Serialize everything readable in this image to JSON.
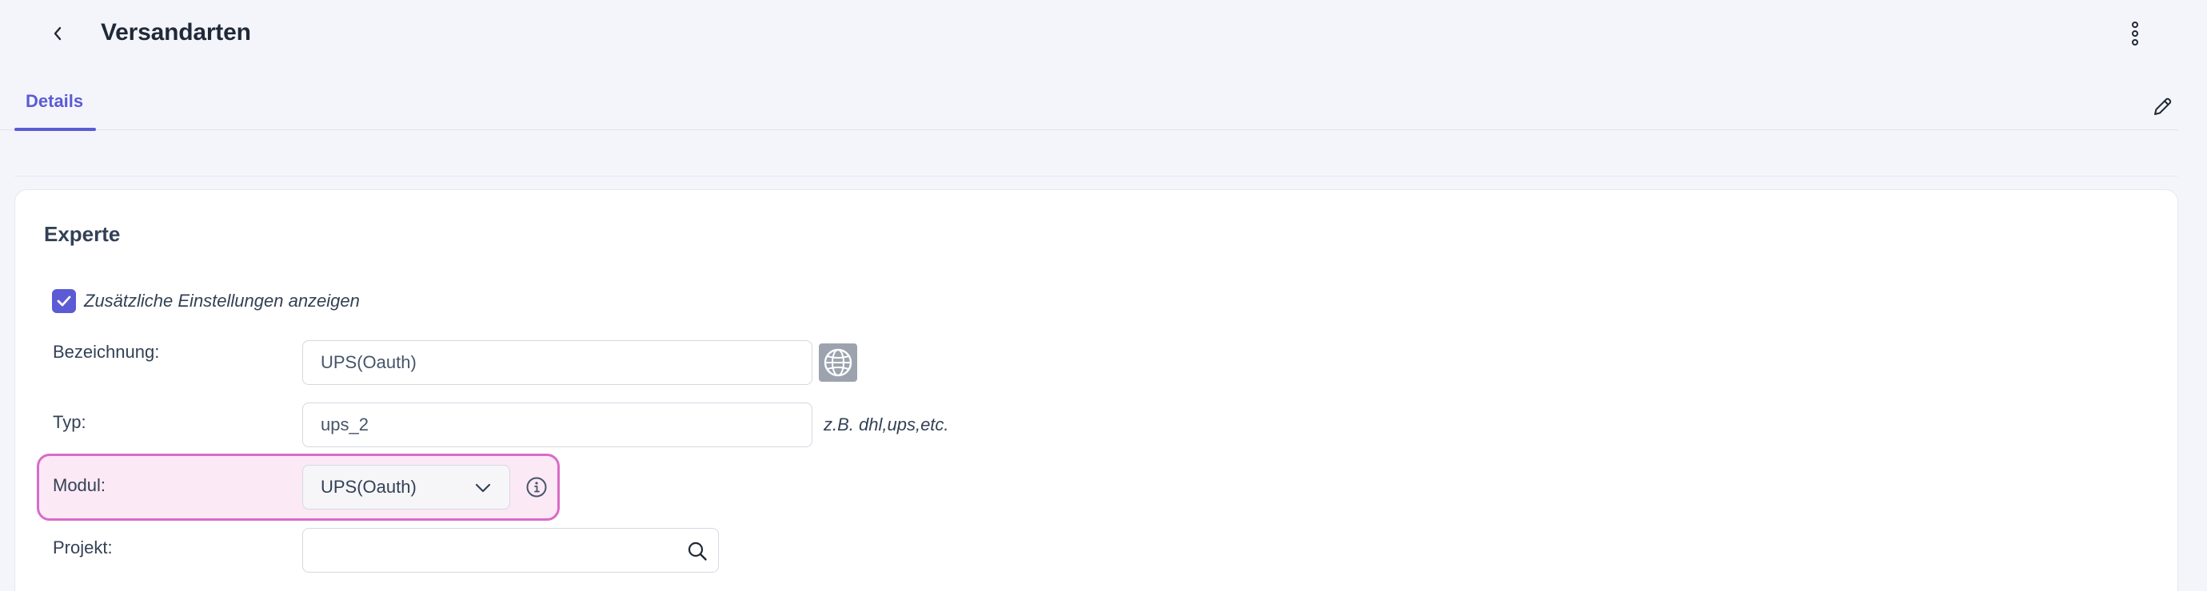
{
  "header": {
    "title": "Versandarten",
    "back_icon": "chevron-left-icon",
    "menu_icon": "kebab-menu-icon"
  },
  "tabs": [
    {
      "label": "Details",
      "active": true
    }
  ],
  "edit_icon": "pencil-icon",
  "section": {
    "title": "Experte",
    "show_extra_settings": {
      "label": "Zusätzliche Einstellungen anzeigen",
      "checked": true
    },
    "fields": {
      "bezeichnung": {
        "label": "Bezeichnung:",
        "value": "UPS(Oauth)",
        "translate_icon": "globe-icon"
      },
      "typ": {
        "label": "Typ:",
        "value": "ups_2",
        "hint": "z.B. dhl,ups,etc."
      },
      "modul": {
        "label": "Modul:",
        "selected": "UPS(Oauth)",
        "info_icon": "info-icon"
      },
      "projekt": {
        "label": "Projekt:",
        "value": "",
        "search_icon": "search-icon"
      }
    }
  },
  "colors": {
    "accent": "#5b5bd6",
    "highlight_border": "#d96bc7",
    "highlight_bg": "#fbe9f6",
    "background": "#f4f5fa"
  }
}
